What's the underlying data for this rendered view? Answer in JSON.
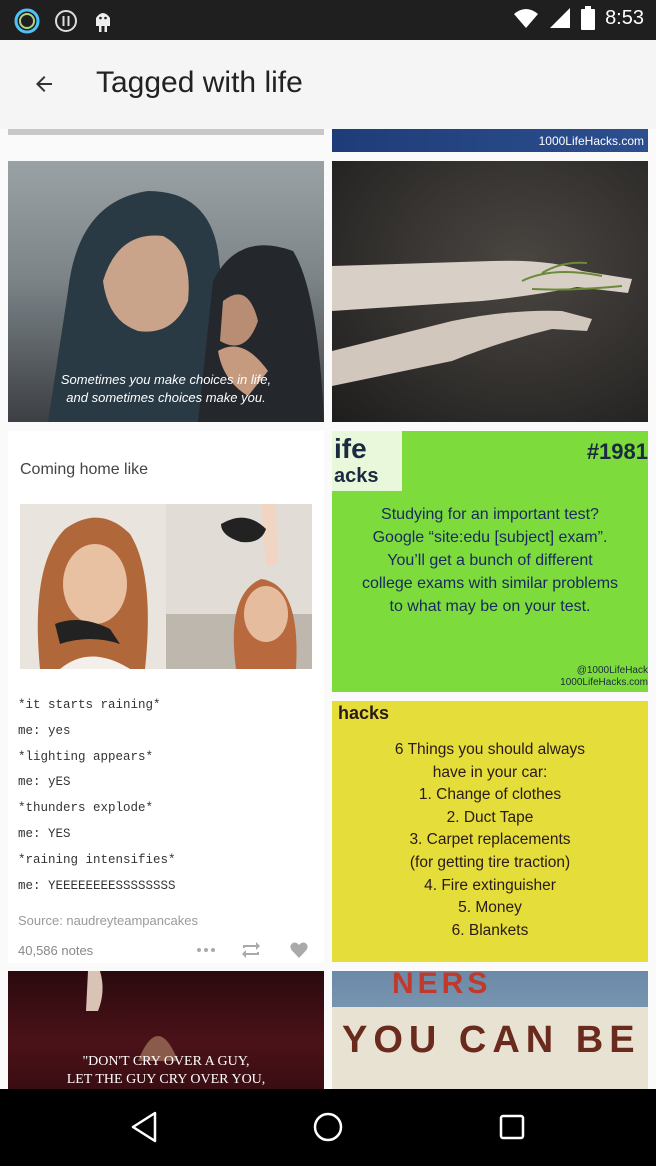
{
  "status_bar": {
    "time": "8:53",
    "icons": [
      "circle-app-icon",
      "info-icon",
      "android-icon",
      "wifi-icon",
      "signal-icon",
      "battery-icon"
    ]
  },
  "app_bar": {
    "title": "Tagged with life",
    "back_icon": "arrow-back-icon"
  },
  "tiles": {
    "top_right_strip": {
      "watermark": "1000LifeHacks.com"
    },
    "kiss": {
      "caption_line1": "Sometimes you make choices in life,",
      "caption_line2": "and sometimes choices make you."
    },
    "coming_home": {
      "heading": "Coming home like",
      "lines": [
        "*it starts raining*",
        "me: yes",
        "*lighting appears*",
        "me: yES",
        "*thunders explode*",
        "me: YES",
        "*raining intensifies*",
        "me: YEEEEEEEESSSSSSSS"
      ],
      "source": "Source: naudreyteampancakes",
      "notes": "40,586 notes"
    },
    "hack_green": {
      "brand_line1": "ife",
      "brand_line2": "acks",
      "number": "#1981",
      "text_lines": [
        "Studying for an important test?",
        "Google “site:edu [subject] exam”.",
        "You’ll get a bunch of different",
        "college exams with similar problems",
        "to what may be on your test."
      ],
      "handle": "@1000LifeHack",
      "site": "1000LifeHacks.com"
    },
    "hack_yellow": {
      "brand": "hacks",
      "text_lines": [
        "6 Things you should always",
        "have in your car:",
        "1. Change of clothes",
        "2. Duct Tape",
        "3. Carpet replacements",
        "(for getting tire traction)",
        "4. Fire extinguisher",
        "5. Money",
        "6. Blankets"
      ]
    },
    "dont_cry": {
      "line1": "\"DON'T CRY OVER A GUY,",
      "line2": "LET THE GUY CRY OVER YOU,"
    },
    "marquee": {
      "sign_top": "NERS",
      "text": "YOU CAN BE"
    }
  },
  "nav_bar": {
    "buttons": [
      "back-triangle-icon",
      "home-circle-icon",
      "recents-square-icon"
    ]
  },
  "colors": {
    "green_tile": "#7ddc3b",
    "yellow_tile": "#e4dd3a",
    "status_bar": "#1f1f1f"
  }
}
